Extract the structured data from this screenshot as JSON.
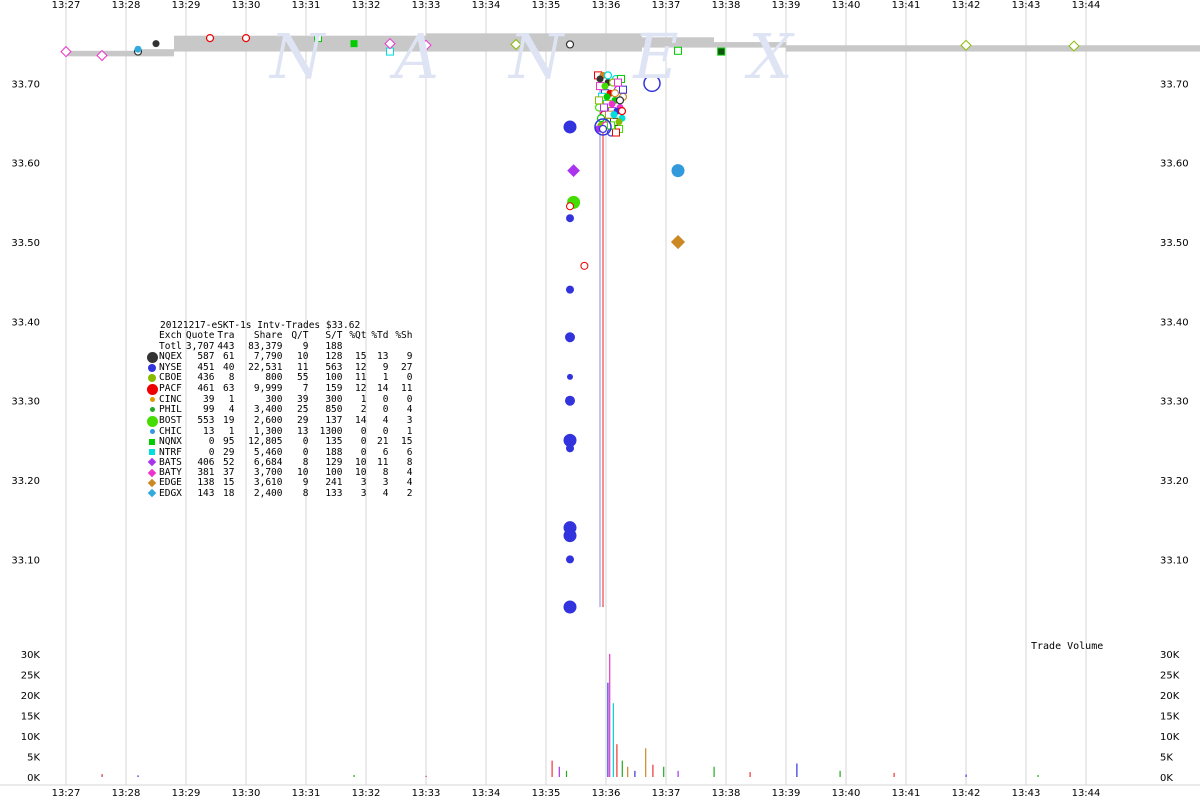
{
  "chart_data": {
    "type": "scatter",
    "title": "20121217-eSKT-1s Intv-Trades $33.62",
    "watermark": "NANEX",
    "x_tick_labels": [
      "13:27",
      "13:28",
      "13:29",
      "13:30",
      "13:31",
      "13:32",
      "13:33",
      "13:34",
      "13:35",
      "13:36",
      "13:37",
      "13:38",
      "13:39",
      "13:40",
      "13:41",
      "13:42",
      "13:43",
      "13:44"
    ],
    "price_axis": {
      "ylim": [
        33.035,
        33.805
      ],
      "ticks": [
        "33.10",
        "33.20",
        "33.30",
        "33.40",
        "33.50",
        "33.60",
        "33.70"
      ]
    },
    "volume_axis": {
      "label": "Trade Volume",
      "ylim": [
        0,
        30000
      ],
      "ticks": [
        "0K",
        "5K",
        "10K",
        "15K",
        "20K",
        "25K",
        "30K"
      ]
    },
    "colors": {
      "NQEX": "#333333",
      "NYSE": "#3333dd",
      "CBOE": "#88bb00",
      "PACF": "#ee0000",
      "CINC": "#dd9900",
      "PHIL": "#22aa22",
      "BOST": "#44dd00",
      "CHIC": "#3399dd",
      "NQNX": "#00cc00",
      "NTRF": "#00dddd",
      "BATS": "#aa33ee",
      "BATY": "#ee33cc",
      "EDGE": "#cc8822",
      "EDGX": "#33aadd",
      "nbbo": "#c8c8c8",
      "price_line": "#ee2222"
    },
    "stats": {
      "headers": [
        "Exch",
        "Quote",
        "Tra",
        "Share",
        "Q/T",
        "S/T",
        "%Qt",
        "%Td",
        "%Sh"
      ],
      "total": [
        "Totl",
        "3,707",
        "443",
        "83,379",
        "9",
        "188",
        "",
        "",
        ""
      ],
      "rows": [
        {
          "ex": "NQEX",
          "shape": "dot-big",
          "vals": [
            "587",
            "61",
            "7,790",
            "10",
            "128",
            "15",
            "13",
            "9"
          ]
        },
        {
          "ex": "NYSE",
          "shape": "dot",
          "vals": [
            "451",
            "40",
            "22,531",
            "11",
            "563",
            "12",
            "9",
            "27"
          ]
        },
        {
          "ex": "CBOE",
          "shape": "dot",
          "vals": [
            "436",
            "8",
            "800",
            "55",
            "100",
            "11",
            "1",
            "0"
          ]
        },
        {
          "ex": "PACF",
          "shape": "dot-big",
          "vals": [
            "461",
            "63",
            "9,999",
            "7",
            "159",
            "12",
            "14",
            "11"
          ]
        },
        {
          "ex": "CINC",
          "shape": "dot-small",
          "vals": [
            "39",
            "1",
            "300",
            "39",
            "300",
            "1",
            "0",
            "0"
          ]
        },
        {
          "ex": "PHIL",
          "shape": "dot-small",
          "vals": [
            "99",
            "4",
            "3,400",
            "25",
            "850",
            "2",
            "0",
            "4"
          ]
        },
        {
          "ex": "BOST",
          "shape": "dot-big",
          "vals": [
            "553",
            "19",
            "2,600",
            "29",
            "137",
            "14",
            "4",
            "3"
          ]
        },
        {
          "ex": "CHIC",
          "shape": "dot-small",
          "vals": [
            "13",
            "1",
            "1,300",
            "13",
            "1300",
            "0",
            "0",
            "1"
          ]
        },
        {
          "ex": "NQNX",
          "shape": "square",
          "vals": [
            "0",
            "95",
            "12,805",
            "0",
            "135",
            "0",
            "21",
            "15"
          ]
        },
        {
          "ex": "NTRF",
          "shape": "square",
          "vals": [
            "0",
            "29",
            "5,460",
            "0",
            "188",
            "0",
            "6",
            "6"
          ]
        },
        {
          "ex": "BATS",
          "shape": "diamond",
          "vals": [
            "406",
            "52",
            "6,684",
            "8",
            "129",
            "10",
            "11",
            "8"
          ]
        },
        {
          "ex": "BATY",
          "shape": "diamond",
          "vals": [
            "381",
            "37",
            "3,700",
            "10",
            "100",
            "10",
            "8",
            "4"
          ]
        },
        {
          "ex": "EDGE",
          "shape": "diamond",
          "vals": [
            "138",
            "15",
            "3,610",
            "9",
            "241",
            "3",
            "3",
            "4"
          ]
        },
        {
          "ex": "EDGX",
          "shape": "diamond",
          "vals": [
            "143",
            "18",
            "2,400",
            "8",
            "133",
            "3",
            "4",
            "2"
          ]
        }
      ]
    },
    "nbbo_band": [
      [
        13.45,
        33.741,
        33.734
      ],
      [
        13.47,
        33.743,
        33.734
      ],
      [
        13.48,
        33.76,
        33.74
      ],
      [
        13.55,
        33.763,
        33.74
      ],
      [
        13.61,
        33.758,
        33.745
      ],
      [
        13.63,
        33.752,
        33.745
      ],
      [
        13.65,
        33.748,
        33.74
      ],
      [
        13.88,
        33.746,
        33.737
      ],
      [
        13.95,
        33.744,
        33.737
      ],
      [
        13.99,
        33.74,
        33.735
      ],
      [
        14.01,
        33.712,
        33.695
      ],
      [
        14.03,
        33.7,
        33.685
      ],
      [
        14.05,
        33.696,
        33.68
      ],
      [
        14.15,
        33.693,
        33.68
      ],
      [
        14.17,
        33.705,
        33.69
      ],
      [
        14.25,
        33.705,
        33.698
      ],
      [
        14.35,
        33.705,
        33.698
      ],
      [
        14.4,
        33.707,
        33.699
      ],
      [
        14.52,
        33.707,
        33.699
      ],
      [
        14.6,
        33.705,
        33.69
      ],
      [
        14.64,
        33.7,
        33.682
      ],
      [
        14.67,
        33.695,
        33.675
      ],
      [
        14.74,
        33.687,
        33.662
      ],
      [
        14.77,
        33.677,
        33.66
      ]
    ],
    "trades_big_drop": [
      {
        "x": 13.59,
        "y": 33.645,
        "ex": "NYSE",
        "size": "big"
      },
      {
        "x": 13.591,
        "y": 33.59,
        "ex": "BATS",
        "size": "mid"
      },
      {
        "x": 13.591,
        "y": 33.55,
        "ex": "BOST",
        "size": "big"
      },
      {
        "x": 13.59,
        "y": 33.545,
        "ex": "PACF",
        "size": "small"
      },
      {
        "x": 13.59,
        "y": 33.53,
        "ex": "NYSE",
        "size": "small"
      },
      {
        "x": 13.594,
        "y": 33.47,
        "ex": "PACF",
        "size": "small"
      },
      {
        "x": 13.59,
        "y": 33.44,
        "ex": "NYSE",
        "size": "small"
      },
      {
        "x": 13.59,
        "y": 33.38,
        "ex": "NYSE",
        "size": "mid"
      },
      {
        "x": 13.59,
        "y": 33.33,
        "ex": "NYSE",
        "size": "tiny"
      },
      {
        "x": 13.59,
        "y": 33.3,
        "ex": "NYSE",
        "size": "mid"
      },
      {
        "x": 13.59,
        "y": 33.25,
        "ex": "NYSE",
        "size": "big"
      },
      {
        "x": 13.59,
        "y": 33.24,
        "ex": "NYSE",
        "size": "small"
      },
      {
        "x": 13.59,
        "y": 33.14,
        "ex": "NYSE",
        "size": "big"
      },
      {
        "x": 13.59,
        "y": 33.13,
        "ex": "NYSE",
        "size": "big"
      },
      {
        "x": 13.59,
        "y": 33.1,
        "ex": "NYSE",
        "size": "small"
      },
      {
        "x": 13.59,
        "y": 33.04,
        "ex": "NYSE",
        "size": "big"
      },
      {
        "x": 13.62,
        "y": 33.59,
        "ex": "CHIC",
        "size": "big"
      },
      {
        "x": 13.62,
        "y": 33.5,
        "ex": "EDGE",
        "size": "diamond"
      }
    ],
    "trades": [
      {
        "x": 13.45,
        "y": 33.74,
        "ex": "BATY",
        "shape": "diamond-o"
      },
      {
        "x": 13.46,
        "y": 33.735,
        "ex": "BATY",
        "shape": "diamond-o"
      },
      {
        "x": 13.47,
        "y": 33.74,
        "ex": "NQEX",
        "shape": "circle-o"
      },
      {
        "x": 13.47,
        "y": 33.743,
        "ex": "EDGX",
        "shape": "dot"
      },
      {
        "x": 13.475,
        "y": 33.75,
        "ex": "NQEX",
        "shape": "dot"
      },
      {
        "x": 13.49,
        "y": 33.757,
        "ex": "PACF",
        "shape": "circle-o"
      },
      {
        "x": 13.5,
        "y": 33.757,
        "ex": "PACF",
        "shape": "circle-o"
      },
      {
        "x": 13.52,
        "y": 33.757,
        "ex": "NQNX",
        "shape": "square-o"
      },
      {
        "x": 13.53,
        "y": 33.75,
        "ex": "NQNX",
        "shape": "square"
      },
      {
        "x": 13.54,
        "y": 33.74,
        "ex": "NTRF",
        "shape": "square-o"
      },
      {
        "x": 13.54,
        "y": 33.75,
        "ex": "BATY",
        "shape": "diamond-o"
      },
      {
        "x": 13.55,
        "y": 33.748,
        "ex": "BATY",
        "shape": "diamond-o"
      },
      {
        "x": 13.575,
        "y": 33.749,
        "ex": "CBOE",
        "shape": "diamond-o"
      },
      {
        "x": 13.59,
        "y": 33.749,
        "ex": "NQEX",
        "shape": "circle-o"
      },
      {
        "x": 13.62,
        "y": 33.741,
        "ex": "NQNX",
        "shape": "square-o"
      },
      {
        "x": 13.632,
        "y": 33.74,
        "ex": "NQEX",
        "shape": "square-dark"
      },
      {
        "x": 13.7,
        "y": 33.748,
        "ex": "CBOE",
        "shape": "diamond-o"
      },
      {
        "x": 13.73,
        "y": 33.747,
        "ex": "CBOE",
        "shape": "diamond-o"
      },
      {
        "x": 13.77,
        "y": 33.745,
        "ex": "BATY",
        "shape": "diamond-o"
      },
      {
        "x": 13.8,
        "y": 33.743,
        "ex": "NQNX",
        "shape": "square-o"
      },
      {
        "x": 13.8,
        "y": 33.739,
        "ex": "NQNX",
        "shape": "square-o"
      },
      {
        "x": 13.82,
        "y": 33.742,
        "ex": "NQNX",
        "shape": "square-o"
      },
      {
        "x": 13.855,
        "y": 33.743,
        "ex": "NQNX",
        "shape": "square-o"
      },
      {
        "x": 13.85,
        "y": 33.741,
        "ex": "NQEX",
        "shape": "circle-o"
      },
      {
        "x": 13.87,
        "y": 33.738,
        "ex": "NQNX",
        "shape": "square-o"
      },
      {
        "x": 13.96,
        "y": 33.7,
        "ex": "NQEX",
        "shape": "circle-o"
      },
      {
        "x": 13.98,
        "y": 33.7,
        "ex": "PACF",
        "shape": "dot"
      },
      {
        "x": 13.99,
        "y": 33.69,
        "ex": "NYSE",
        "shape": "dot"
      },
      {
        "x": 14.0,
        "y": 33.705,
        "ex": "BATS",
        "shape": "diamond"
      },
      {
        "x": 14.01,
        "y": 33.66,
        "ex": "NQNX",
        "shape": "square-o"
      },
      {
        "x": 14.03,
        "y": 33.7,
        "ex": "PACF",
        "shape": "circle-o"
      },
      {
        "x": 14.03,
        "y": 33.69,
        "ex": "CBOE",
        "shape": "dot"
      },
      {
        "x": 14.05,
        "y": 33.7,
        "ex": "NYSE",
        "shape": "circle-o"
      },
      {
        "x": 14.06,
        "y": 33.71,
        "ex": "BATS",
        "shape": "diamond"
      },
      {
        "x": 14.1,
        "y": 33.68,
        "ex": "NQNX",
        "shape": "square-o"
      },
      {
        "x": 14.15,
        "y": 33.68,
        "ex": "PACF",
        "shape": "circle-o"
      },
      {
        "x": 14.17,
        "y": 33.7,
        "ex": "NTRF",
        "shape": "square-o"
      },
      {
        "x": 14.2,
        "y": 33.7,
        "ex": "NYSE",
        "shape": "dot"
      },
      {
        "x": 14.23,
        "y": 33.7,
        "ex": "NQNX",
        "shape": "square-o"
      },
      {
        "x": 14.25,
        "y": 33.7,
        "ex": "BATY",
        "shape": "diamond"
      },
      {
        "x": 14.27,
        "y": 33.7,
        "ex": "NQEX",
        "shape": "circle-o"
      },
      {
        "x": 14.3,
        "y": 33.7,
        "ex": "NTRF",
        "shape": "square-o"
      },
      {
        "x": 14.35,
        "y": 33.7,
        "ex": "NQNX",
        "shape": "square-o"
      },
      {
        "x": 14.37,
        "y": 33.7,
        "ex": "NQEX",
        "shape": "circle-o"
      },
      {
        "x": 14.4,
        "y": 33.7,
        "ex": "NQEX",
        "shape": "circle-o"
      },
      {
        "x": 14.4,
        "y": 33.607,
        "ex": "NQEX",
        "shape": "square-dark"
      },
      {
        "x": 14.48,
        "y": 33.71,
        "ex": "PACF",
        "shape": "circle-o"
      },
      {
        "x": 14.5,
        "y": 33.7,
        "ex": "NYSE",
        "shape": "dot"
      },
      {
        "x": 14.58,
        "y": 33.7,
        "ex": "NQNX",
        "shape": "square-o"
      },
      {
        "x": 14.6,
        "y": 33.7,
        "ex": "NQEX",
        "shape": "dot"
      },
      {
        "x": 14.62,
        "y": 33.7,
        "ex": "BATY",
        "shape": "diamond"
      },
      {
        "x": 14.63,
        "y": 33.68,
        "ex": "NQNX",
        "shape": "square-o"
      },
      {
        "x": 14.65,
        "y": 33.71,
        "ex": "NTRF",
        "shape": "square-o"
      },
      {
        "x": 14.67,
        "y": 33.7,
        "ex": "PACF",
        "shape": "dot"
      },
      {
        "x": 14.68,
        "y": 33.68,
        "ex": "NYSE",
        "shape": "circle-o"
      },
      {
        "x": 14.7,
        "y": 33.7,
        "ex": "BATY",
        "shape": "diamond"
      },
      {
        "x": 14.72,
        "y": 33.7,
        "ex": "PHIL",
        "shape": "dot"
      },
      {
        "x": 14.73,
        "y": 33.68,
        "ex": "BATY",
        "shape": "diamond-o"
      },
      {
        "x": 14.75,
        "y": 33.7,
        "ex": "NYSE",
        "shape": "circle-o"
      },
      {
        "x": 14.76,
        "y": 33.69,
        "ex": "BATS",
        "shape": "diamond"
      },
      {
        "x": 14.78,
        "y": 33.69,
        "ex": "NTRF",
        "shape": "square-o"
      },
      {
        "x": 14.8,
        "y": 33.7,
        "ex": "NYSE",
        "shape": "dot"
      },
      {
        "x": 14.85,
        "y": 33.67,
        "ex": "NQEX",
        "shape": "circle-o"
      },
      {
        "x": 14.93,
        "y": 33.667,
        "ex": "EDGE",
        "shape": "diamond"
      },
      {
        "x": 14.95,
        "y": 33.68,
        "ex": "NTRF",
        "shape": "square-o"
      },
      {
        "x": 14.95,
        "y": 33.67,
        "ex": "NTRF",
        "shape": "square-o"
      }
    ],
    "volume_bars": [
      {
        "x": 13.46,
        "v": 700,
        "c": "#cc3333"
      },
      {
        "x": 13.47,
        "v": 400,
        "c": "#3333dd"
      },
      {
        "x": 13.53,
        "v": 500,
        "c": "#22aa22"
      },
      {
        "x": 13.55,
        "v": 300,
        "c": "#cc3333"
      },
      {
        "x": 13.91,
        "v": 300,
        "c": "#3333dd"
      },
      {
        "x": 14.13,
        "v": 400,
        "c": "#22aa22"
      },
      {
        "x": 14.16,
        "v": 300,
        "c": "#cc3333"
      },
      {
        "x": 14.25,
        "v": 250,
        "c": "#22aa22"
      },
      {
        "x": 14.46,
        "v": 250,
        "c": "#3333dd"
      },
      {
        "x": 14.68,
        "v": 250,
        "c": "#cc3333"
      },
      {
        "x": 14.58,
        "v": 2300,
        "c": "#3333dd"
      },
      {
        "x": 14.59,
        "v": 400,
        "c": "#22aa22"
      },
      {
        "x": 14.6,
        "v": 300,
        "c": "#cc3333"
      },
      {
        "x": 14.72,
        "v": 400,
        "c": "#22aa22"
      },
      {
        "x": 14.76,
        "v": 300,
        "c": "#3333dd"
      },
      {
        "x": 14.84,
        "v": 250,
        "c": "#cc3333"
      },
      {
        "x": 14.97,
        "v": 600,
        "c": "#00cccc"
      },
      {
        "x": 13.585,
        "v": 4000,
        "c": "#ee3333"
      },
      {
        "x": 13.587,
        "v": 2500,
        "c": "#aa33ee"
      },
      {
        "x": 13.589,
        "v": 1500,
        "c": "#22aa22"
      },
      {
        "x": 13.6005,
        "v": 23000,
        "c": "#3333dd"
      },
      {
        "x": 13.601,
        "v": 30000,
        "c": "#ee33cc"
      },
      {
        "x": 13.602,
        "v": 18000,
        "c": "#00cccc"
      },
      {
        "x": 13.603,
        "v": 8000,
        "c": "#ee3333"
      },
      {
        "x": 13.6045,
        "v": 4000,
        "c": "#22aa22"
      },
      {
        "x": 13.606,
        "v": 2500,
        "c": "#cc8822"
      },
      {
        "x": 13.608,
        "v": 1500,
        "c": "#3333dd"
      },
      {
        "x": 13.611,
        "v": 7000,
        "c": "#cc8822"
      },
      {
        "x": 13.613,
        "v": 3000,
        "c": "#ee3333"
      },
      {
        "x": 13.616,
        "v": 2500,
        "c": "#22aa22"
      },
      {
        "x": 13.62,
        "v": 1500,
        "c": "#aa33ee"
      },
      {
        "x": 13.63,
        "v": 2500,
        "c": "#22aa22"
      },
      {
        "x": 13.64,
        "v": 1200,
        "c": "#ee3333"
      },
      {
        "x": 13.653,
        "v": 3300,
        "c": "#3333dd"
      },
      {
        "x": 13.665,
        "v": 1500,
        "c": "#22aa22"
      },
      {
        "x": 13.68,
        "v": 1000,
        "c": "#ee3333"
      },
      {
        "x": 13.7,
        "v": 600,
        "c": "#3333dd"
      },
      {
        "x": 13.72,
        "v": 500,
        "c": "#22aa22"
      }
    ]
  }
}
